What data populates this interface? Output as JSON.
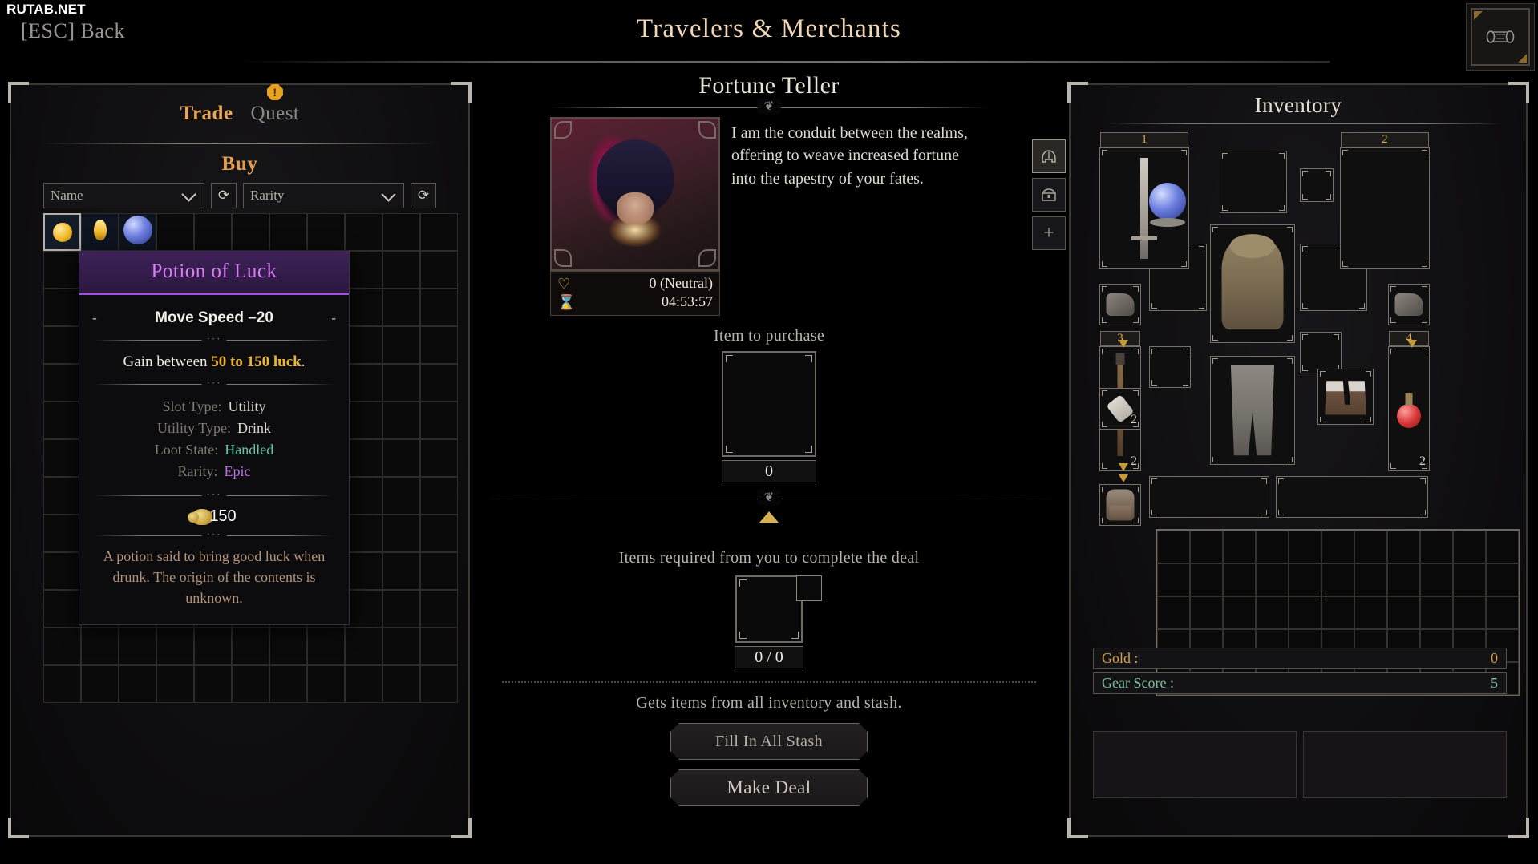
{
  "watermark": "RUTAB.NET",
  "topbar": {
    "back_label": "[ESC] Back",
    "title": "Travelers & Merchants",
    "scroll_icon": "scroll-icon"
  },
  "trade": {
    "tabs": [
      {
        "label": "Trade",
        "active": true
      },
      {
        "label": "Quest",
        "active": false,
        "badge": "!"
      }
    ],
    "section_title": "Buy",
    "filters": [
      {
        "label": "Name",
        "refresh": "refresh-icon"
      },
      {
        "label": "Rarity",
        "refresh": "refresh-icon"
      }
    ],
    "shop_items": [
      {
        "slot": 0,
        "icon": "yellow-potion",
        "selected": true
      },
      {
        "slot": 1,
        "icon": "yellow-flask",
        "selected": false
      },
      {
        "slot": 2,
        "icon": "blue-orb",
        "selected": false
      }
    ]
  },
  "tooltip": {
    "title": "Potion of Luck",
    "rarity_color": "#c06fe8",
    "stat_left_dash": "-",
    "stat_right_dash": "-",
    "stat": "Move Speed –20",
    "effect_prefix": "Gain between ",
    "effect_value": "50 to 150 luck",
    "effect_suffix": ".",
    "properties": [
      {
        "key": "Slot Type:",
        "value": "Utility",
        "style": "normal"
      },
      {
        "key": "Utility Type:",
        "value": "Drink",
        "style": "normal"
      },
      {
        "key": "Loot State:",
        "value": "Handled",
        "style": "teal"
      },
      {
        "key": "Rarity:",
        "value": "Epic",
        "style": "epic"
      }
    ],
    "price": "150",
    "flavor": "A potion said to bring good luck when drunk. The origin of the contents is unknown."
  },
  "npc": {
    "name": "Fortune Teller",
    "quote": "I am the conduit between the realms, offering to weave increased fortune into the tapestry of your fates.",
    "reputation_icon": "heart-icon",
    "reputation": "0 (Neutral)",
    "timer_icon": "hourglass-icon",
    "timer": "04:53:57"
  },
  "deal": {
    "purchase_label": "Item to purchase",
    "purchase_count": "0",
    "arrow_icon": "up-triangle-icon",
    "required_label": "Items required from you to complete the deal",
    "required_count": "0 / 0",
    "hint": "Gets items from all inventory and stash.",
    "fill_button": "Fill In All Stash",
    "deal_button": "Make Deal"
  },
  "inventory": {
    "title": "Inventory",
    "side_tabs": [
      {
        "icon": "helmet-icon",
        "active": true
      },
      {
        "icon": "chest-icon",
        "active": false
      },
      {
        "icon": "plus-icon",
        "active": false
      }
    ],
    "equipment": [
      {
        "name": "weapon-slot-1",
        "number": "1",
        "art": "sword",
        "qty": ""
      },
      {
        "name": "offhand-orb",
        "art": "orb",
        "qty": ""
      },
      {
        "name": "weapon-slot-2",
        "number": "2",
        "art": "",
        "qty": ""
      },
      {
        "name": "head-slot",
        "art": "",
        "qty": ""
      },
      {
        "name": "neck-slot",
        "art": "",
        "qty": ""
      },
      {
        "name": "chest-slot",
        "art": "tunic",
        "qty": ""
      },
      {
        "name": "hands-slot-left",
        "art": "gauntlet",
        "qty": ""
      },
      {
        "name": "hands-slot-right",
        "art": "gauntlet",
        "qty": ""
      },
      {
        "name": "utility-slot-3",
        "number": "3",
        "art": "torch",
        "qty": "2"
      },
      {
        "name": "utility-bandage",
        "art": "bandage",
        "qty": "2"
      },
      {
        "name": "utility-slot-4",
        "number": "4",
        "art": "red-potion",
        "qty": "2"
      },
      {
        "name": "legs-slot",
        "art": "pants",
        "qty": ""
      },
      {
        "name": "feet-slot",
        "art": "boots",
        "qty": ""
      },
      {
        "name": "backpack-slot",
        "art": "backpack",
        "qty": ""
      }
    ],
    "gold_label": "Gold :",
    "gold_value": "0",
    "gear_label": "Gear Score :",
    "gear_value": "5"
  }
}
